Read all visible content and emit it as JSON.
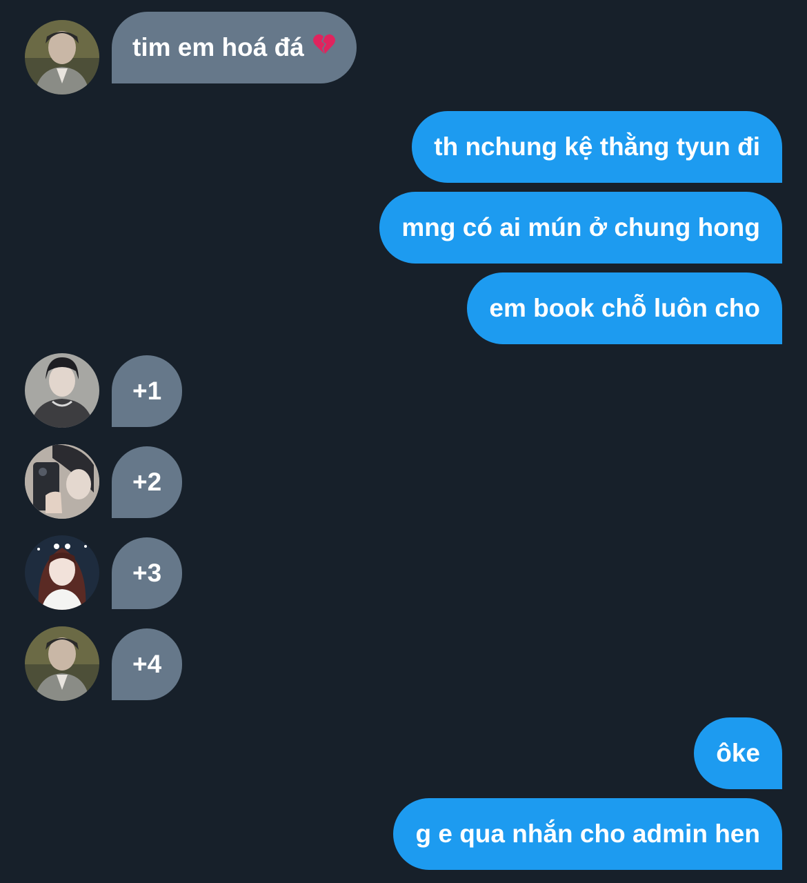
{
  "messages": [
    {
      "direction": "incoming",
      "text": "tim em hoá đá",
      "emoji": "broken-heart-icon"
    },
    {
      "direction": "outgoing",
      "text": "th nchung kệ thằng tyun đi"
    },
    {
      "direction": "outgoing",
      "text": "mng có ai mún ở chung hong"
    },
    {
      "direction": "outgoing",
      "text": "em book chỗ luôn cho"
    },
    {
      "direction": "incoming",
      "text": "+1"
    },
    {
      "direction": "incoming",
      "text": "+2"
    },
    {
      "direction": "incoming",
      "text": "+3"
    },
    {
      "direction": "incoming",
      "text": "+4"
    },
    {
      "direction": "outgoing",
      "text": "ôke"
    },
    {
      "direction": "outgoing",
      "text": "g e qua nhắn cho admin hen"
    }
  ],
  "colors": {
    "background": "#17202a",
    "incoming_bubble": "#66788a",
    "outgoing_bubble": "#1d9bf0",
    "text": "#ffffff"
  }
}
